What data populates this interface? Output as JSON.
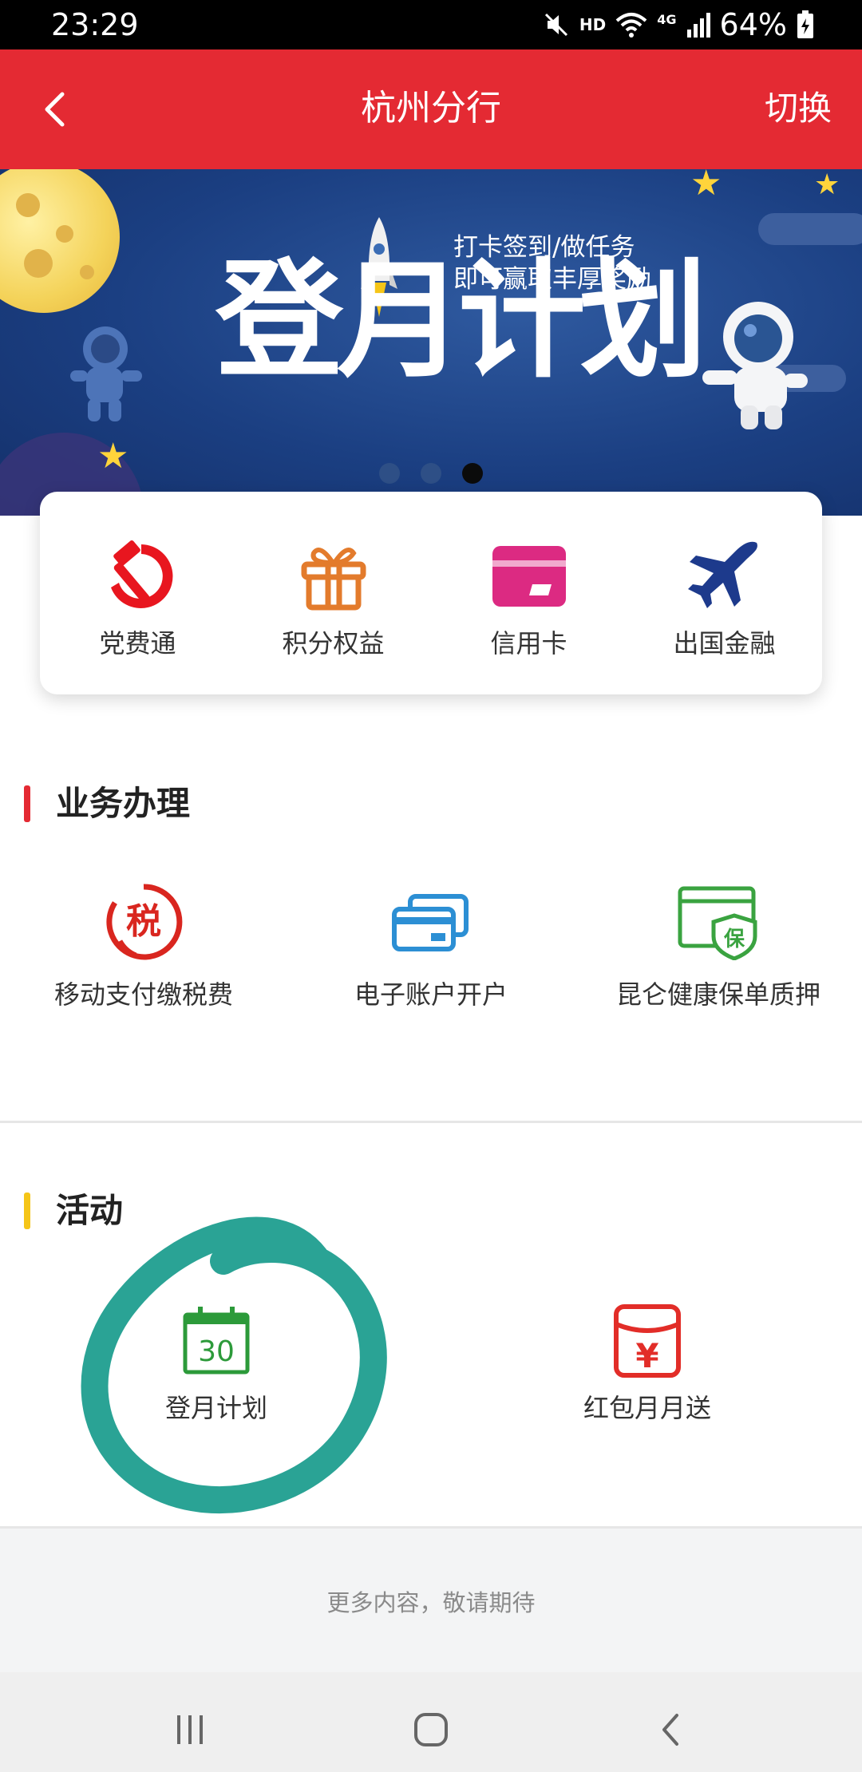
{
  "status_bar": {
    "time": "23:29",
    "hd": "HD",
    "network": "4G",
    "battery": "64%"
  },
  "nav": {
    "title": "杭州分行",
    "switch_label": "切换"
  },
  "banner": {
    "title": "登月计划",
    "slogan_line1": "打卡签到/做任务",
    "slogan_line2": "即可赢取丰厚奖励",
    "slide_count": 3,
    "active_slide": 3
  },
  "quick_links": [
    {
      "label": "党费通",
      "icon": "hammer-sickle-icon"
    },
    {
      "label": "积分权益",
      "icon": "gift-icon"
    },
    {
      "label": "信用卡",
      "icon": "credit-card-icon"
    },
    {
      "label": "出国金融",
      "icon": "airplane-icon"
    }
  ],
  "business": {
    "title": "业务办理",
    "accent": "#e42a33",
    "items": [
      {
        "label": "移动支付缴税费",
        "icon": "tax-icon",
        "icon_text": "税"
      },
      {
        "label": "电子账户开户",
        "icon": "bank-cards-icon"
      },
      {
        "label": "昆仑健康保单质押",
        "icon": "insurance-shield-icon",
        "icon_text": "保"
      }
    ]
  },
  "activities": {
    "title": "活动",
    "accent": "#f5c518",
    "items": [
      {
        "label": "登月计划",
        "icon": "calendar-icon",
        "icon_text": "30"
      },
      {
        "label": "红包月月送",
        "icon": "red-envelope-icon",
        "icon_text": "¥"
      }
    ]
  },
  "footer": {
    "more_text": "更多内容，敬请期待"
  },
  "colors": {
    "brand_red": "#e42a33",
    "annotation_circle": "#2aa395"
  }
}
